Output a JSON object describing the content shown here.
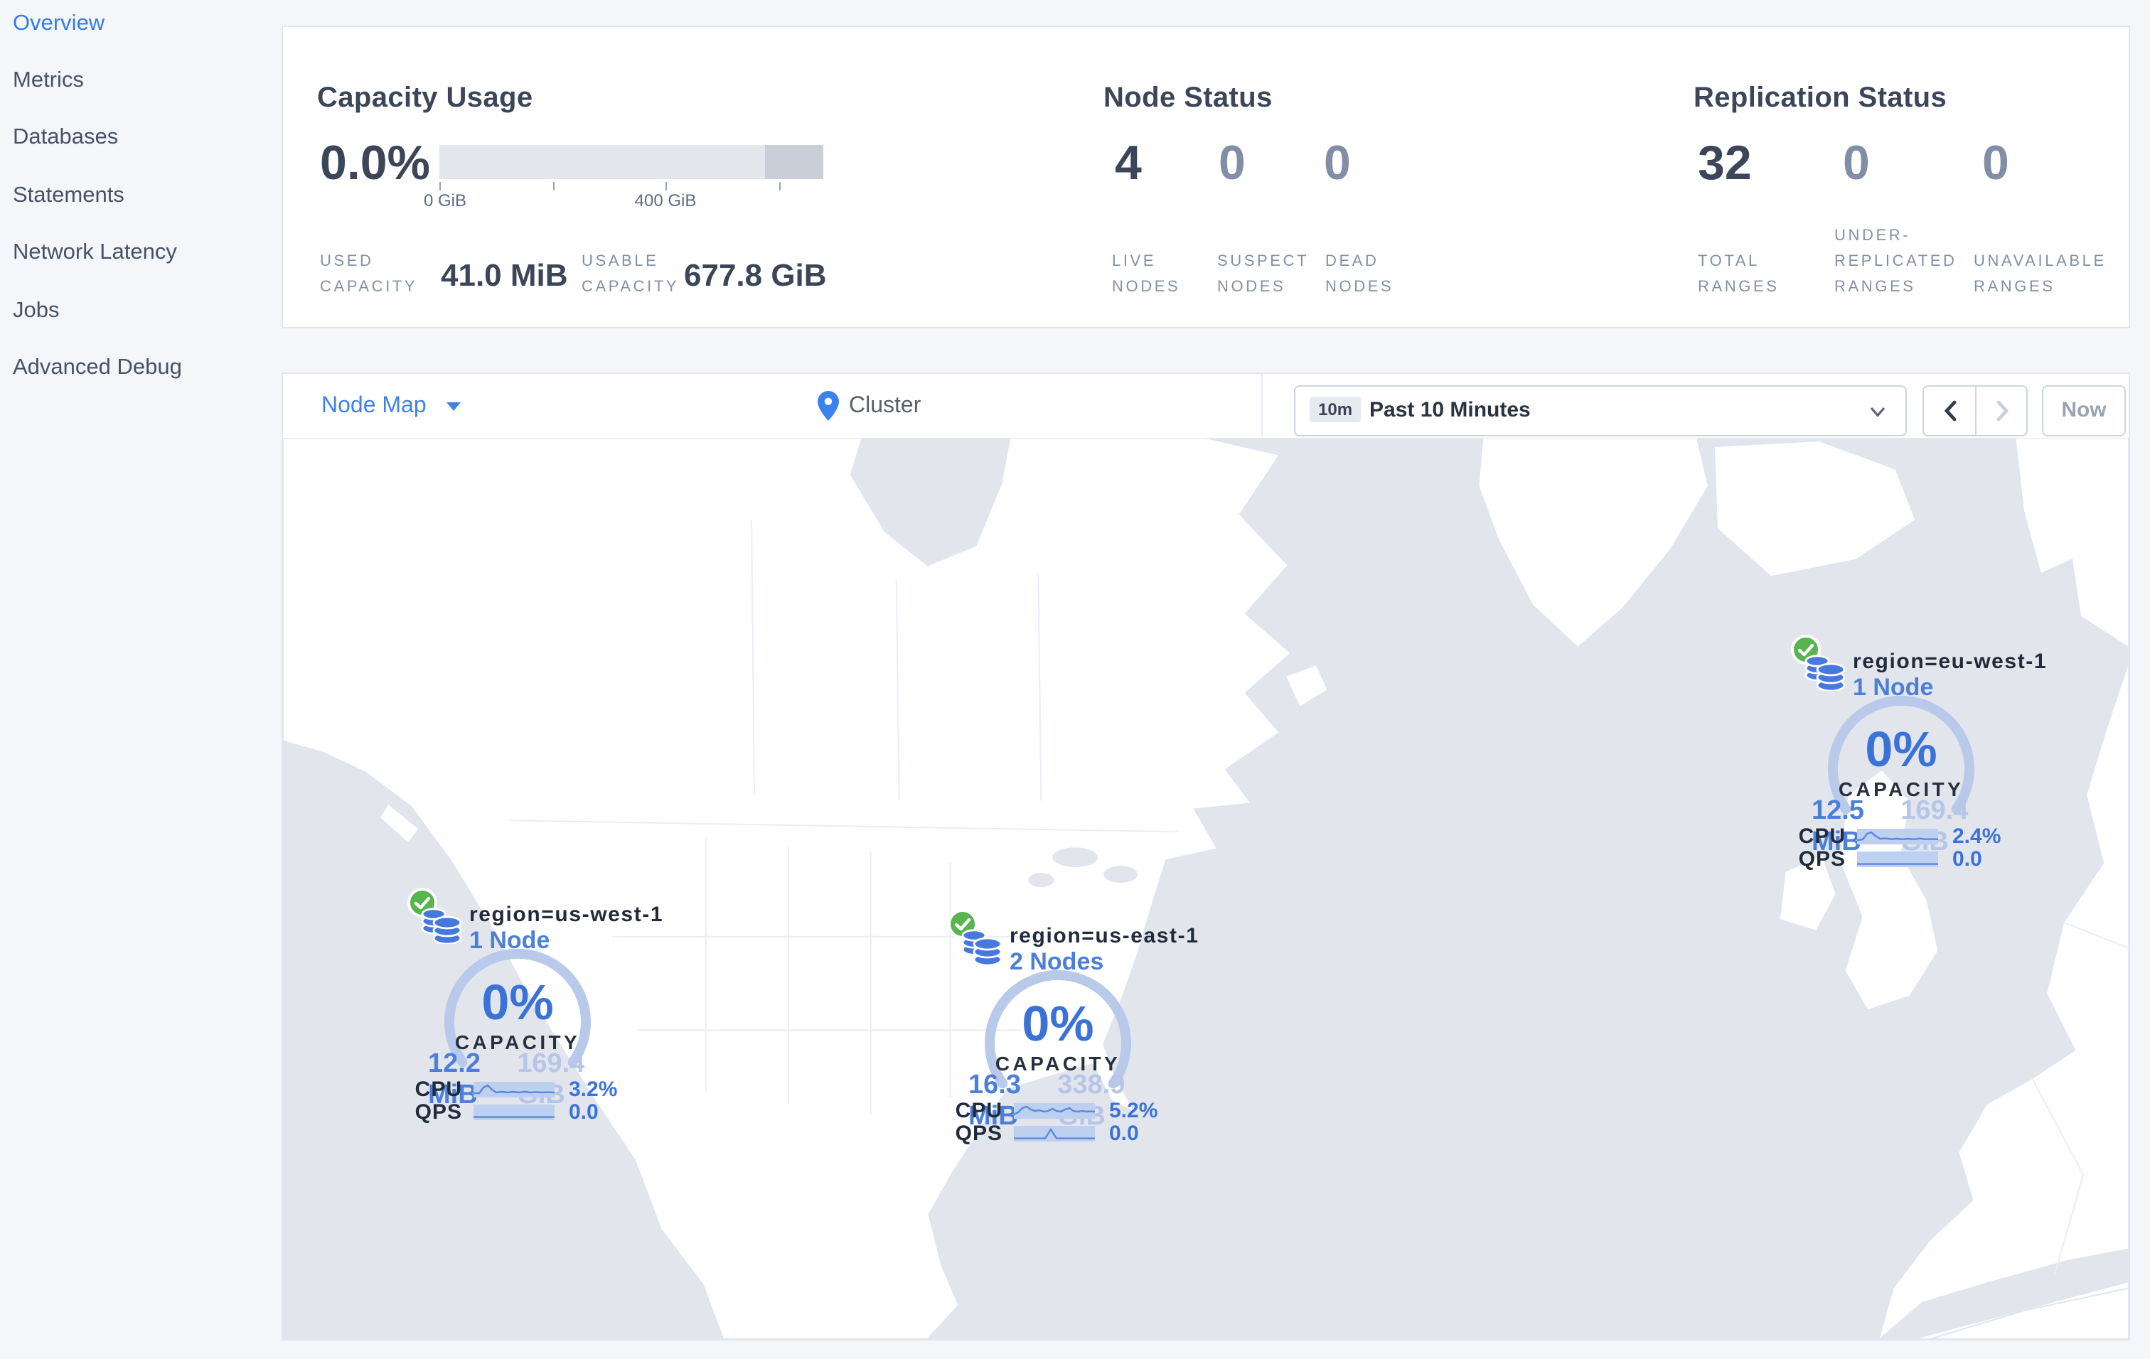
{
  "sidebar": {
    "items": [
      {
        "label": "Overview",
        "active": true
      },
      {
        "label": "Metrics",
        "active": false
      },
      {
        "label": "Databases",
        "active": false
      },
      {
        "label": "Statements",
        "active": false
      },
      {
        "label": "Network Latency",
        "active": false
      },
      {
        "label": "Jobs",
        "active": false
      },
      {
        "label": "Advanced Debug",
        "active": false
      }
    ]
  },
  "summary": {
    "capacity": {
      "title": "Capacity Usage",
      "percent": "0.0%",
      "tick_labels": [
        "0 GiB",
        "400 GiB"
      ],
      "used": {
        "label_line1": "USED",
        "label_line2": "CAPACITY",
        "value": "41.0 MiB"
      },
      "usable": {
        "label_line1": "USABLE",
        "label_line2": "CAPACITY",
        "value": "677.8 GiB"
      }
    },
    "node_status": {
      "title": "Node Status",
      "stats": [
        {
          "value": "4",
          "label_lines": [
            "LIVE",
            "NODES"
          ]
        },
        {
          "value": "0",
          "label_lines": [
            "SUSPECT",
            "NODES"
          ]
        },
        {
          "value": "0",
          "label_lines": [
            "DEAD",
            "NODES"
          ]
        }
      ]
    },
    "replication": {
      "title": "Replication Status",
      "stats": [
        {
          "value": "32",
          "label_lines": [
            "TOTAL",
            "RANGES"
          ]
        },
        {
          "value": "0",
          "label_lines": [
            "UNDER-",
            "REPLICATED",
            "RANGES"
          ]
        },
        {
          "value": "0",
          "label_lines": [
            "UNAVAILABLE",
            "RANGES"
          ]
        }
      ]
    }
  },
  "toolbar": {
    "view_selector": "Node Map",
    "breadcrumb": "Cluster",
    "time": {
      "badge": "10m",
      "label": "Past 10 Minutes"
    },
    "now_label": "Now"
  },
  "map": {
    "regions": [
      {
        "name": "region=us-west-1",
        "nodes": "1 Node",
        "percent": "0%",
        "capacity_label": "CAPACITY",
        "used": "12.2 MiB",
        "total": "169.4 GiB",
        "cpu_label": "CPU",
        "cpu_value": "3.2%",
        "qps_label": "QPS",
        "qps_value": "0.0"
      },
      {
        "name": "region=us-east-1",
        "nodes": "2 Nodes",
        "percent": "0%",
        "capacity_label": "CAPACITY",
        "used": "16.3 MiB",
        "total": "338.9 GiB",
        "cpu_label": "CPU",
        "cpu_value": "5.2%",
        "qps_label": "QPS",
        "qps_value": "0.0"
      },
      {
        "name": "region=eu-west-1",
        "nodes": "1 Node",
        "percent": "0%",
        "capacity_label": "CAPACITY",
        "used": "12.5 MiB",
        "total": "169.4 GiB",
        "cpu_label": "CPU",
        "cpu_value": "2.4%",
        "qps_label": "QPS",
        "qps_value": "0.0"
      }
    ]
  },
  "colors": {
    "accent_blue": "#3f82e8",
    "link_blue": "#4c7fda",
    "dark_slate": "#3c4658",
    "muted_slate": "#828ea6",
    "gauge_arc": "#b9c9ea",
    "success_green": "#57b44f",
    "ocean": "#e2e5ec",
    "land": "#ffffff"
  }
}
